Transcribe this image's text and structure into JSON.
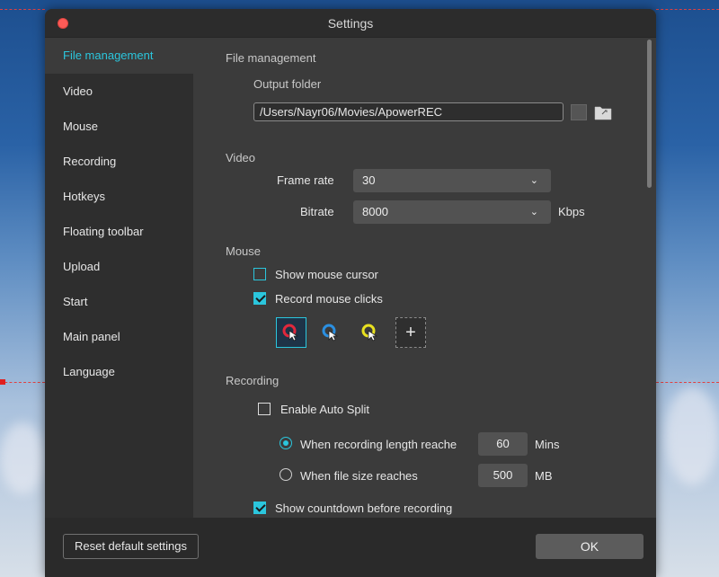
{
  "window": {
    "title": "Settings"
  },
  "sidebar": {
    "items": [
      {
        "label": "File management"
      },
      {
        "label": "Video"
      },
      {
        "label": "Mouse"
      },
      {
        "label": "Recording"
      },
      {
        "label": "Hotkeys"
      },
      {
        "label": "Floating toolbar"
      },
      {
        "label": "Upload"
      },
      {
        "label": "Start"
      },
      {
        "label": "Main panel"
      },
      {
        "label": "Language"
      }
    ],
    "active": "File management"
  },
  "file_management": {
    "section_title": "File management",
    "output_folder_label": "Output folder",
    "output_folder_value": "/Users/Nayr06/Movies/ApowerREC"
  },
  "video": {
    "section_title": "Video",
    "frame_rate_label": "Frame rate",
    "frame_rate_value": "30",
    "bitrate_label": "Bitrate",
    "bitrate_value": "8000",
    "bitrate_unit": "Kbps"
  },
  "mouse": {
    "section_title": "Mouse",
    "show_cursor_label": "Show mouse cursor",
    "show_cursor_checked": false,
    "record_clicks_label": "Record mouse clicks",
    "record_clicks_checked": true,
    "cursor_styles": [
      {
        "icon": "red-click-cursor-icon",
        "color": "#e0283c",
        "selected": true
      },
      {
        "icon": "blue-click-cursor-icon",
        "color": "#2b8fe0",
        "selected": false
      },
      {
        "icon": "yellow-click-cursor-icon",
        "color": "#e8e020",
        "selected": false
      }
    ],
    "add_label": "+"
  },
  "recording": {
    "section_title": "Recording",
    "auto_split_label": "Enable Auto Split",
    "auto_split_checked": false,
    "length_label": "When recording length reache",
    "length_value": "60",
    "length_unit": "Mins",
    "length_selected": true,
    "size_label": "When file size reaches",
    "size_value": "500",
    "size_unit": "MB",
    "countdown_label": "Show countdown before recording",
    "countdown_checked": true
  },
  "footer": {
    "reset_label": "Reset default settings",
    "ok_label": "OK"
  },
  "colors": {
    "accent": "#2bc6dd",
    "close": "#fc5b57"
  }
}
